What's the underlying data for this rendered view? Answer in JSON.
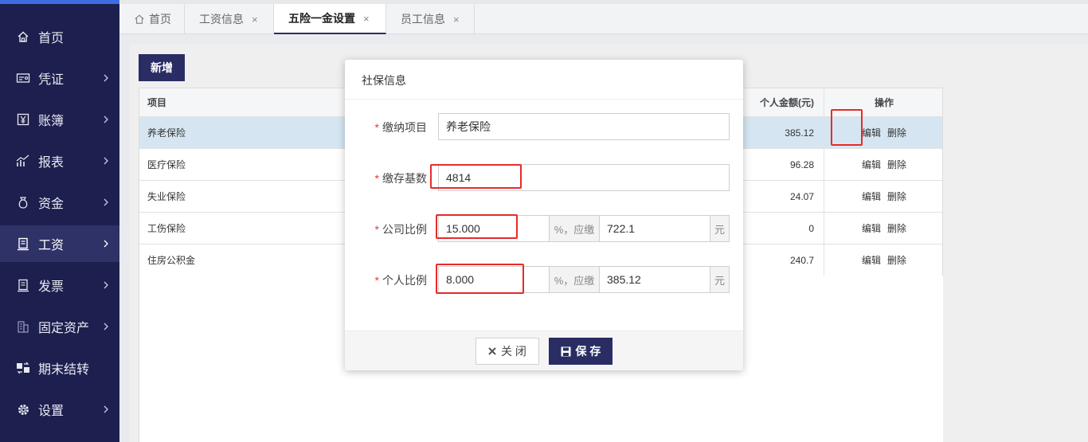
{
  "sidebar": {
    "items": [
      {
        "label": "首页",
        "icon": "home-icon"
      },
      {
        "label": "凭证",
        "icon": "voucher-icon"
      },
      {
        "label": "账簿",
        "icon": "yen-icon"
      },
      {
        "label": "报表",
        "icon": "chart-icon"
      },
      {
        "label": "资金",
        "icon": "money-bag-icon"
      },
      {
        "label": "工资",
        "icon": "payroll-icon"
      },
      {
        "label": "发票",
        "icon": "invoice-icon"
      },
      {
        "label": "固定资产",
        "icon": "building-icon"
      },
      {
        "label": "期末结转",
        "icon": "transfer-icon"
      },
      {
        "label": "设置",
        "icon": "gear-icon"
      }
    ]
  },
  "tabs": [
    {
      "label": "首页"
    },
    {
      "label": "工资信息",
      "close": "×"
    },
    {
      "label": "五险一金设置",
      "close": "×"
    },
    {
      "label": "员工信息",
      "close": "×"
    }
  ],
  "toolbar": {
    "add_label": "新增"
  },
  "table": {
    "headers": {
      "name": "项目",
      "amount": "个人金额(元)",
      "ops": "操作"
    },
    "rows": [
      {
        "name": "养老保险",
        "amount": "385.12"
      },
      {
        "name": "医疗保险",
        "amount": "96.28"
      },
      {
        "name": "失业保险",
        "amount": "24.07"
      },
      {
        "name": "工伤保险",
        "amount": "0"
      },
      {
        "name": "住房公积金",
        "amount": "240.7"
      }
    ],
    "edit_label": "编辑",
    "delete_label": "删除"
  },
  "modal": {
    "title": "社保信息",
    "required_mark": "*",
    "fields": {
      "item": {
        "label": "缴纳项目",
        "value": "养老保险"
      },
      "base": {
        "label": "缴存基数",
        "value": "4814"
      },
      "company": {
        "label": "公司比例",
        "ratio": "15.000",
        "suffix": "%，应缴",
        "amount": "722.1",
        "unit": "元"
      },
      "personal": {
        "label": "个人比例",
        "ratio": "8.000",
        "suffix": "%，应缴",
        "amount": "385.12",
        "unit": "元"
      }
    },
    "close_label": "关 闭",
    "save_label": "保 存"
  }
}
